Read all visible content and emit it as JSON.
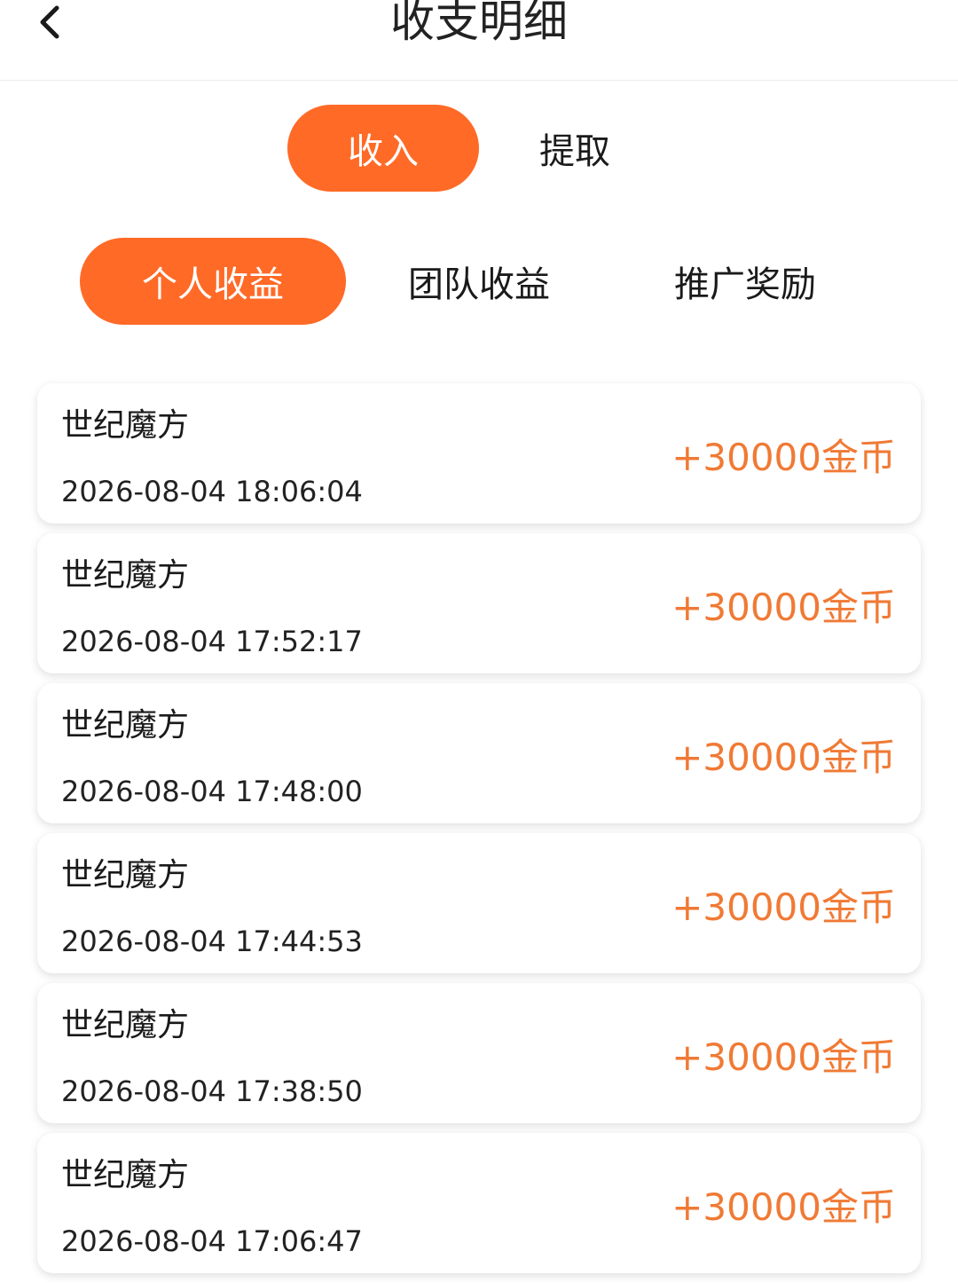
{
  "header": {
    "title": "收支明细",
    "back_icon": "chevron-left-icon"
  },
  "main_tabs": [
    {
      "label": "收入",
      "active": true
    },
    {
      "label": "提取",
      "active": false
    }
  ],
  "sub_tabs": [
    {
      "label": "个人收益",
      "active": true
    },
    {
      "label": "团队收益",
      "active": false
    },
    {
      "label": "推广奖励",
      "active": false
    }
  ],
  "records": [
    {
      "name": "世纪魔方",
      "time": "2026-08-04 18:06:04",
      "amount": "+30000金币"
    },
    {
      "name": "世纪魔方",
      "time": "2026-08-04 17:52:17",
      "amount": "+30000金币"
    },
    {
      "name": "世纪魔方",
      "time": "2026-08-04 17:48:00",
      "amount": "+30000金币"
    },
    {
      "name": "世纪魔方",
      "time": "2026-08-04 17:44:53",
      "amount": "+30000金币"
    },
    {
      "name": "世纪魔方",
      "time": "2026-08-04 17:38:50",
      "amount": "+30000金币"
    },
    {
      "name": "世纪魔方",
      "time": "2026-08-04 17:06:47",
      "amount": "+30000金币"
    }
  ],
  "colors": {
    "accent": "#ff6a26",
    "amount": "#f07a35"
  }
}
